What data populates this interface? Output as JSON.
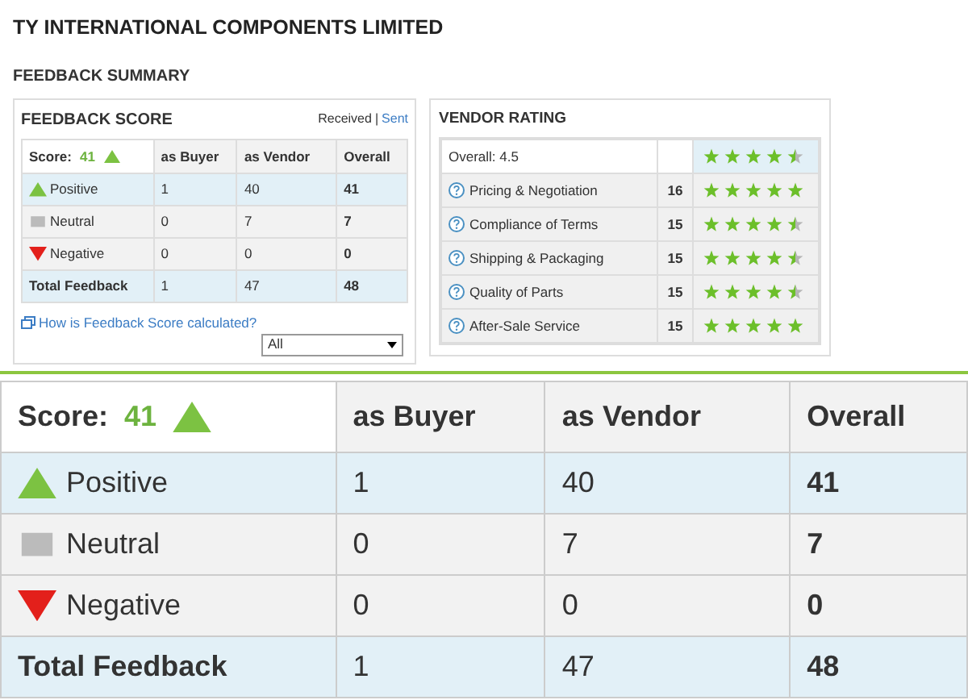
{
  "company_title": "TY INTERNATIONAL COMPONENTS LIMITED",
  "section_title": "FEEDBACK SUMMARY",
  "feedback_score": {
    "title": "FEEDBACK SCORE",
    "links": [
      {
        "label": "Received",
        "selected": true
      },
      {
        "label": "Sent",
        "selected": false
      }
    ],
    "separator": "|",
    "table": {
      "score_label": "Score:",
      "score": "41",
      "columns": [
        "as Buyer",
        "as Vendor",
        "Overall"
      ],
      "rows": [
        {
          "kind": "positive",
          "label": "Positive",
          "cells": [
            "1",
            "40",
            "41"
          ]
        },
        {
          "kind": "neutral",
          "label": "Neutral",
          "cells": [
            "0",
            "7",
            "7"
          ]
        },
        {
          "kind": "negative",
          "label": "Negative",
          "cells": [
            "0",
            "0",
            "0"
          ]
        },
        {
          "kind": "total",
          "label": "Total Feedback",
          "cells": [
            "1",
            "47",
            "48"
          ]
        }
      ]
    },
    "help_link": "How is Feedback Score calculated?",
    "filter": {
      "value": "All"
    }
  },
  "vendor_rating": {
    "title": "VENDOR RATING",
    "overall": {
      "label": "Overall: 4.5",
      "stars": 4.5
    },
    "rows": [
      {
        "label": "Pricing & Negotiation",
        "count": "16",
        "stars": 5
      },
      {
        "label": "Compliance of Terms",
        "count": "15",
        "stars": 4.5
      },
      {
        "label": "Shipping & Packaging",
        "count": "15",
        "stars": 4.5
      },
      {
        "label": "Quality of Parts",
        "count": "15",
        "stars": 4.5
      },
      {
        "label": "After-Sale Service",
        "count": "15",
        "stars": 5
      }
    ]
  },
  "enlarged_table": {
    "score_label": "Score:",
    "score": "41",
    "columns": [
      "as Buyer",
      "as Vendor",
      "Overall"
    ],
    "rows": [
      {
        "kind": "positive",
        "label": "Positive",
        "cells": [
          "1",
          "40",
          "41"
        ]
      },
      {
        "kind": "neutral",
        "label": "Neutral",
        "cells": [
          "0",
          "7",
          "7"
        ]
      },
      {
        "kind": "negative",
        "label": "Negative",
        "cells": [
          "0",
          "0",
          "0"
        ]
      },
      {
        "kind": "total",
        "label": "Total Feedback",
        "cells": [
          "1",
          "47",
          "48"
        ]
      }
    ]
  }
}
